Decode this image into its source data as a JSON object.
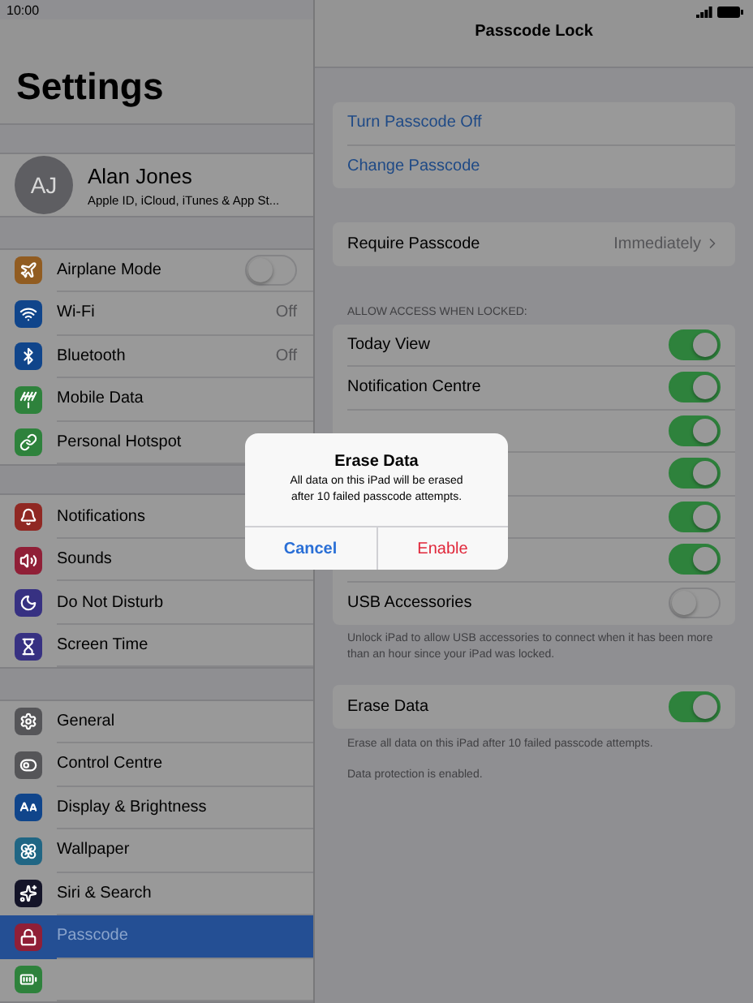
{
  "status_bar": {
    "time": "10:00"
  },
  "sidebar": {
    "title": "Settings",
    "profile": {
      "initials": "AJ",
      "name": "Alan Jones",
      "subtitle": "Apple ID, iCloud, iTunes & App St..."
    },
    "sections": [
      {
        "items": [
          {
            "label": "Airplane Mode",
            "color": "#915c21",
            "kind": "toggle",
            "on": false,
            "selected": false
          },
          {
            "label": "Wi-Fi",
            "color": "#10458b",
            "kind": "value",
            "value": "Off",
            "selected": false
          },
          {
            "label": "Bluetooth",
            "color": "#10458b",
            "kind": "value",
            "value": "Off",
            "selected": false
          },
          {
            "label": "Mobile Data",
            "color": "#2e823c",
            "kind": "plain",
            "selected": false
          },
          {
            "label": "Personal Hotspot",
            "color": "#2e823c",
            "kind": "plain",
            "selected": false
          }
        ]
      },
      {
        "items": [
          {
            "label": "Notifications",
            "color": "#902823",
            "kind": "plain",
            "selected": false
          },
          {
            "label": "Sounds",
            "color": "#901f37",
            "kind": "plain",
            "selected": false
          },
          {
            "label": "Do Not Disturb",
            "color": "#373182",
            "kind": "plain",
            "selected": false
          },
          {
            "label": "Screen Time",
            "color": "#373182",
            "kind": "plain",
            "selected": false
          }
        ]
      },
      {
        "items": [
          {
            "label": "General",
            "color": "#555558",
            "kind": "plain",
            "selected": false
          },
          {
            "label": "Control Centre",
            "color": "#555558",
            "kind": "plain",
            "selected": false
          },
          {
            "label": "Display & Brightness",
            "color": "#10458b",
            "kind": "plain",
            "selected": false
          },
          {
            "label": "Wallpaper",
            "color": "#206684",
            "kind": "plain",
            "selected": false
          },
          {
            "label": "Siri & Search",
            "color": "#141428",
            "kind": "plain",
            "selected": false
          },
          {
            "label": "Passcode",
            "color": "#901f37",
            "kind": "plain",
            "selected": true
          },
          {
            "color": "#2e823c",
            "kind": "plain",
            "selected": false
          }
        ]
      }
    ]
  },
  "detail": {
    "title": "Passcode Lock",
    "actions": [
      "Turn Passcode Off",
      "Change Passcode"
    ],
    "require": {
      "label": "Require Passcode",
      "value": "Immediately"
    },
    "access_header": "ALLOW ACCESS WHEN LOCKED:",
    "access": [
      {
        "label": "Today View",
        "on": true
      },
      {
        "label": "Notification Centre",
        "on": true
      },
      {
        "on": true
      },
      {
        "on": true
      },
      {
        "on": true
      },
      {
        "on": true
      },
      {
        "label": "USB Accessories",
        "on": false
      }
    ],
    "access_note": "Unlock iPad to allow USB accessories to connect when it has been more than an hour since your iPad was locked.",
    "erase": {
      "label": "Erase Data",
      "on": true
    },
    "erase_notes": [
      "Erase all data on this iPad after 10 failed passcode attempts.",
      "Data protection is enabled."
    ]
  },
  "alert": {
    "title": "Erase Data",
    "message": "All data on this iPad will be erased after 10 failed passcode attempts.",
    "buttons": [
      {
        "label": "Cancel",
        "kind": "cancel"
      },
      {
        "label": "Enable",
        "kind": "destructive"
      }
    ]
  }
}
